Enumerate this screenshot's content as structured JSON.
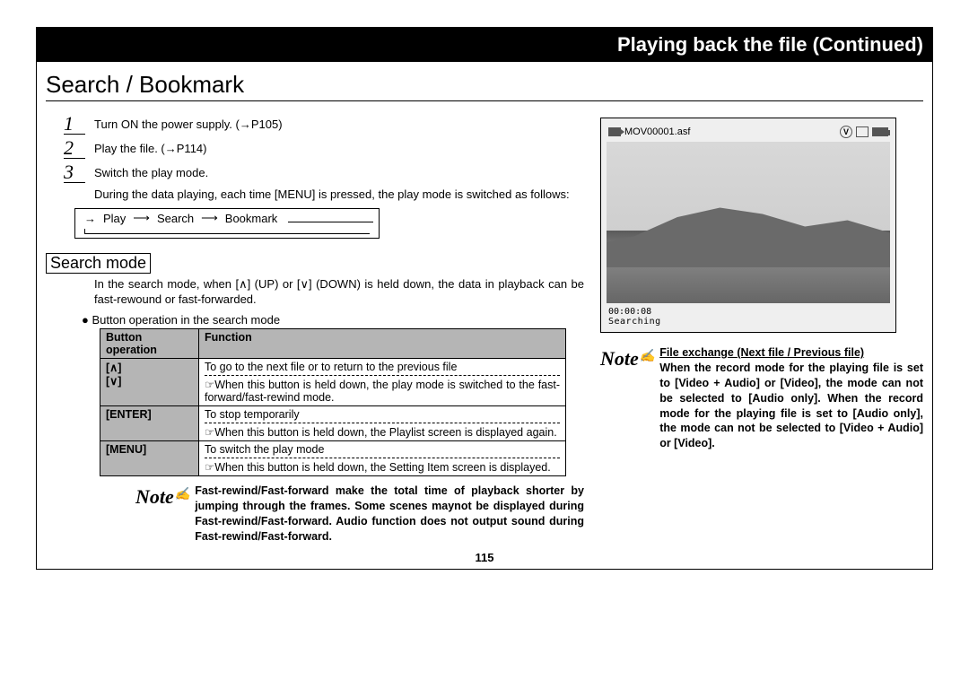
{
  "header": "Playing back the file (Continued)",
  "section_title": "Search / Bookmark",
  "steps": [
    {
      "num": "1",
      "text": "Turn ON the power supply. (→P105)"
    },
    {
      "num": "2",
      "text": "Play the file. (→P114)"
    },
    {
      "num": "3",
      "text": "Switch the play mode."
    }
  ],
  "step3_sub": "During the data playing, each time [MENU] is pressed, the play mode is switched as follows:",
  "flow": {
    "a": "Play",
    "b": "Search",
    "c": "Bookmark"
  },
  "search_mode_label": "Search mode",
  "search_mode_para": "In the search mode, when [∧] (UP) or [∨] (DOWN) is held down, the data in playback can be fast-rewound or fast-forwarded.",
  "ops_bullet": "Button operation in the search mode",
  "table": {
    "head1": "Button operation",
    "head2": "Function",
    "row1": {
      "btn": "[∧]\n[∨]",
      "line1": "To go to the next file or to return to the previous file",
      "line2": "☞When this button is held down, the play mode is switched to the fast-forward/fast-rewind mode."
    },
    "row2": {
      "btn": "[ENTER]",
      "line1": "To stop temporarily",
      "line2": "☞When this button is held down, the Playlist screen is displayed again."
    },
    "row3": {
      "btn": "[MENU]",
      "line1": "To switch the play mode",
      "line2": "☞When this button is held down, the Setting Item screen is displayed."
    }
  },
  "left_note": "Fast-rewind/Fast-forward make the total time of playback shorter by jumping through the frames. Some scenes maynot be displayed during Fast-rewind/Fast-forward. Audio function does not output sound during Fast-rewind/Fast-forward.",
  "screen": {
    "filename": "MOV00001.asf",
    "v": "V",
    "time": "00:00:08",
    "status": "Searching"
  },
  "right_note_title": "File exchange (Next file / Previous file)",
  "right_note_body": "When the record mode for the playing file is set to [Video + Audio] or [Video], the mode can not be selected to [Audio only]. When the record mode for the playing file is set to [Audio only], the mode can not be selected to [Video + Audio] or [Video].",
  "page_number": "115"
}
